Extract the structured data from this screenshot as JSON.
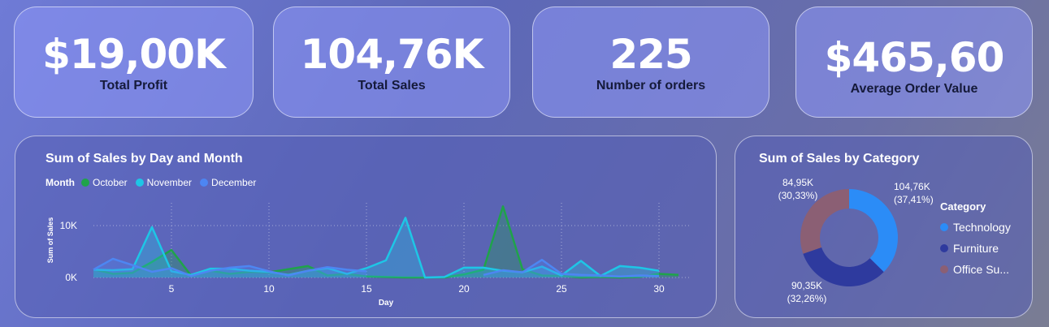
{
  "kpis": [
    {
      "value": "$19,00K",
      "label": "Total Profit"
    },
    {
      "value": "104,76K",
      "label": "Total Sales"
    },
    {
      "value": "225",
      "label": "Number of orders"
    },
    {
      "value": "$465,60",
      "label": "Average Order Value"
    }
  ],
  "chart_data": [
    {
      "type": "area",
      "title": "Sum of Sales by Day and Month",
      "xlabel": "Day",
      "ylabel": "Sum of Sales",
      "legend_title": "Month",
      "legend_position": "top-left",
      "grid": true,
      "xlim": [
        1,
        31
      ],
      "ylim": [
        0,
        12500
      ],
      "x_ticks": [
        5,
        10,
        15,
        20,
        25,
        30
      ],
      "y_ticks": [
        0,
        10000
      ],
      "y_tick_labels": [
        "0K",
        "10K"
      ],
      "x": [
        1,
        2,
        3,
        4,
        5,
        6,
        7,
        8,
        9,
        10,
        11,
        12,
        13,
        14,
        15,
        16,
        17,
        18,
        19,
        20,
        21,
        22,
        23,
        24,
        25,
        26,
        27,
        28,
        29,
        30,
        31
      ],
      "series": [
        {
          "name": "October",
          "color": "#1fa34a",
          "values": [
            1600,
            700,
            900,
            3000,
            5300,
            400,
            1300,
            700,
            1100,
            1000,
            1600,
            2200,
            400,
            700,
            200,
            100,
            0,
            0,
            0,
            600,
            1500,
            13700,
            1600,
            400,
            300,
            0,
            100,
            0,
            100,
            700,
            500
          ]
        },
        {
          "name": "November",
          "color": "#1ec6e6",
          "values": [
            1500,
            1400,
            1600,
            9700,
            1200,
            500,
            1700,
            1700,
            1300,
            1100,
            500,
            1300,
            1800,
            700,
            1800,
            3300,
            11500,
            0,
            100,
            1900,
            1900,
            1300,
            1000,
            2100,
            400,
            3200,
            300,
            2200,
            1900,
            1300,
            null
          ]
        },
        {
          "name": "December",
          "color": "#4d86f2",
          "values": [
            1500,
            3600,
            2400,
            1100,
            1800,
            300,
            1300,
            1900,
            2200,
            1200,
            400,
            1300,
            2000,
            1500,
            1200,
            null,
            null,
            null,
            null,
            null,
            500,
            1400,
            1000,
            3400,
            700,
            500,
            400,
            200,
            400,
            300,
            null
          ]
        }
      ]
    },
    {
      "type": "pie",
      "donut": true,
      "title": "Sum of Sales by Category",
      "legend_title": "Category",
      "legend_position": "right",
      "slices": [
        {
          "name": "Technology",
          "value": 104.76,
          "label": "104,76K",
          "pct": "(37,41%)",
          "color": "#2b8cf7"
        },
        {
          "name": "Furniture",
          "value": 90.35,
          "label": "90,35K",
          "pct": "(32,26%)",
          "color": "#2e3a9e"
        },
        {
          "name": "Office Su...",
          "value": 84.95,
          "label": "84,95K",
          "pct": "(30,33%)",
          "color": "#8b5f74"
        }
      ]
    }
  ]
}
